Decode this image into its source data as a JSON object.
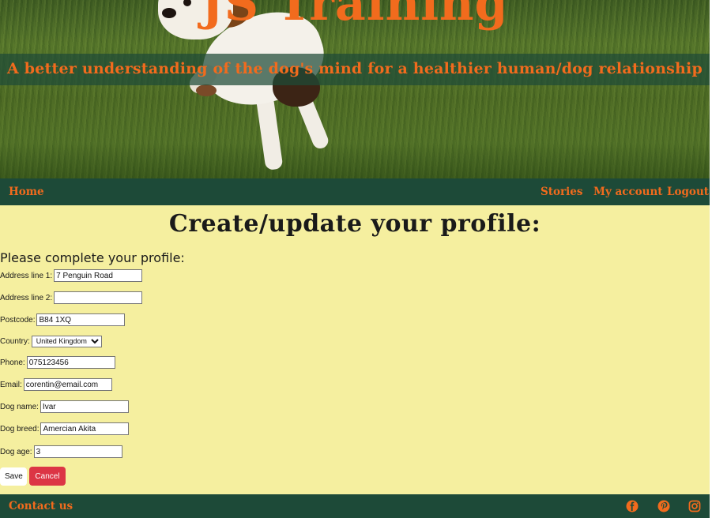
{
  "header": {
    "brand_title": "JS Training",
    "tagline": "A better understanding of the dog's mind for a healthier human/dog relationship"
  },
  "nav": {
    "home": "Home",
    "stories": "Stories",
    "my_account": "My account",
    "logout": "Logout"
  },
  "main": {
    "title": "Create/update your profile:",
    "form_heading": "Please complete your profile:",
    "fields": [
      {
        "label": "Address line 1:",
        "value": "7 Penguin Road"
      },
      {
        "label": "Address line 2:",
        "value": ""
      },
      {
        "label": "Postcode:",
        "value": "B84 1XQ"
      },
      {
        "label": "Country:",
        "value": "United Kingdom"
      },
      {
        "label": "Phone:",
        "value": "075123456"
      },
      {
        "label": "Email:",
        "value": "corentin@email.com"
      },
      {
        "label": "Dog name:",
        "value": "Ivar"
      },
      {
        "label": "Dog breed:",
        "value": "Amercian Akita"
      },
      {
        "label": "Dog age:",
        "value": "3"
      }
    ],
    "save_label": "Save",
    "cancel_label": "Cancel"
  },
  "footer": {
    "contact": "Contact us",
    "social_icons": [
      "facebook-icon",
      "pinterest-icon",
      "instagram-icon"
    ]
  },
  "colors": {
    "accent_orange": "#f26b1d",
    "nav_green": "#1d4a38",
    "page_background": "#f5ef9f",
    "cancel_red": "#dc3545"
  }
}
